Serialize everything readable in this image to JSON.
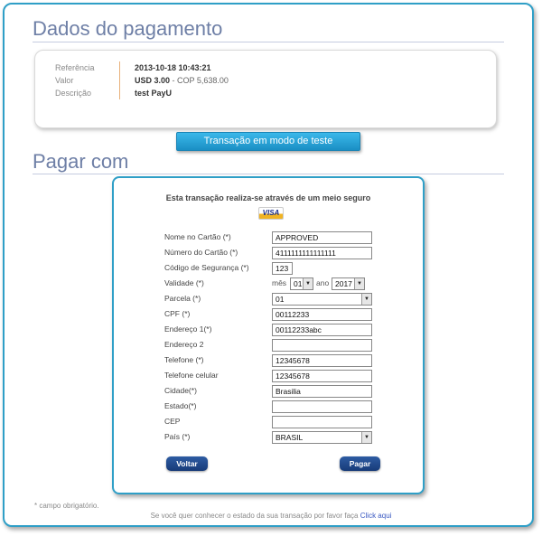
{
  "header": {
    "payment_title": "Dados do pagamento",
    "paywith_title": "Pagar com"
  },
  "summary": {
    "labels": [
      "Referência",
      "Valor",
      "Descrição"
    ],
    "reference": "2013-10-18 10:43:21",
    "amount_bold": "USD 3.00",
    "amount_rest": " - COP 5,638.00",
    "description": "test PayU"
  },
  "test_badge": "Transação em modo de teste",
  "form": {
    "secure_note": "Esta transação realiza-se através de um meio seguro",
    "card_brand": "VISA",
    "fields": {
      "card_name": {
        "label": "Nome no Cartão (*)",
        "value": "APPROVED"
      },
      "card_number": {
        "label": "Número do Cartão (*)",
        "value": "4111111111111111"
      },
      "security_code": {
        "label": "Código de Segurança (*)",
        "value": "123"
      },
      "expiry": {
        "label": "Validade (*)",
        "month_label": "mês",
        "month": "01",
        "year_label": "ano",
        "year": "2017"
      },
      "installments": {
        "label": "Parcela (*)",
        "value": "01"
      },
      "cpf": {
        "label": "CPF (*)",
        "value": "00112233"
      },
      "address1": {
        "label": "Endereço 1(*)",
        "value": "00112233abc"
      },
      "address2": {
        "label": "Endereço 2",
        "value": ""
      },
      "phone": {
        "label": "Telefone (*)",
        "value": "12345678"
      },
      "mobile": {
        "label": "Telefone celular",
        "value": "12345678"
      },
      "city": {
        "label": "Cidade(*)",
        "value": "Brasilia"
      },
      "state": {
        "label": "Estado(*)",
        "value": ""
      },
      "zip": {
        "label": "CEP",
        "value": ""
      },
      "country": {
        "label": "País (*)",
        "value": "BRASIL"
      }
    },
    "back_button": "Voltar",
    "pay_button": "Pagar"
  },
  "footnote": "* campo obrigatório.",
  "footer": {
    "text": "Se você quer conhecer o estado da sua transação por favor faça ",
    "link": "Click aqui"
  },
  "colors": {
    "accent_border": "#2f9fc7",
    "title": "#6e7fa6",
    "button": "#1f4a8c",
    "badge": "#2aa6dc"
  }
}
